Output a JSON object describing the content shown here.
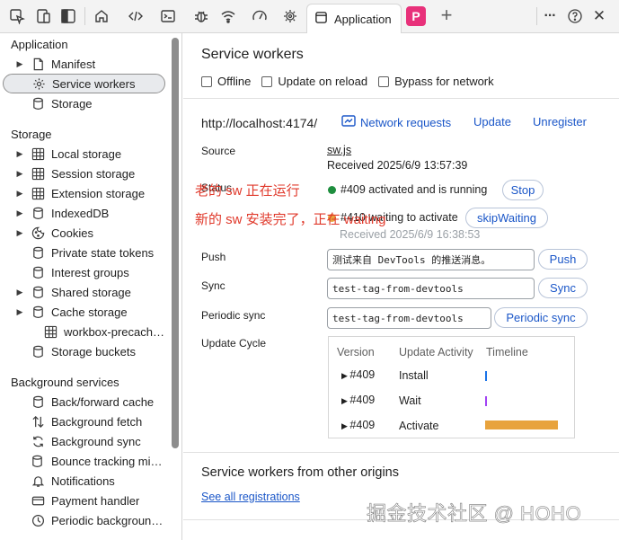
{
  "toolbar": {
    "icons": [
      "inspect-icon",
      "device-toolbar-icon",
      "dock-icon",
      "home-icon",
      "elements-icon",
      "console-icon",
      "sources-icon",
      "network-icon",
      "performance-icon",
      "settings-chip-icon"
    ],
    "active_tab": "Application",
    "badge": "P",
    "new_tab": "+",
    "more": "···",
    "help": "?",
    "close": "✕"
  },
  "sidebar": {
    "application_header": "Application",
    "application_items": [
      {
        "label": "Manifest",
        "icon": "file-icon",
        "arrow": true
      },
      {
        "label": "Service workers",
        "icon": "gear-icon",
        "arrow": false,
        "selected": true
      },
      {
        "label": "Storage",
        "icon": "database-icon",
        "arrow": false
      }
    ],
    "storage_header": "Storage",
    "storage_items": [
      {
        "label": "Local storage",
        "icon": "table-icon",
        "arrow": true
      },
      {
        "label": "Session storage",
        "icon": "table-icon",
        "arrow": true
      },
      {
        "label": "Extension storage",
        "icon": "table-icon",
        "arrow": true
      },
      {
        "label": "IndexedDB",
        "icon": "database-icon",
        "arrow": true
      },
      {
        "label": "Cookies",
        "icon": "cookie-icon",
        "arrow": true
      },
      {
        "label": "Private state tokens",
        "icon": "database-icon",
        "arrow": false
      },
      {
        "label": "Interest groups",
        "icon": "database-icon",
        "arrow": false
      },
      {
        "label": "Shared storage",
        "icon": "database-icon",
        "arrow": true
      },
      {
        "label": "Cache storage",
        "icon": "database-icon",
        "arrow": true
      },
      {
        "label": "workbox-precach…",
        "icon": "table-icon",
        "arrow": false,
        "indent": true
      },
      {
        "label": "Storage buckets",
        "icon": "database-icon",
        "arrow": false
      }
    ],
    "background_header": "Background services",
    "background_items": [
      {
        "label": "Back/forward cache",
        "icon": "database-icon"
      },
      {
        "label": "Background fetch",
        "icon": "up-down-arrows-icon"
      },
      {
        "label": "Background sync",
        "icon": "sync-icon"
      },
      {
        "label": "Bounce tracking mit…",
        "icon": "database-icon"
      },
      {
        "label": "Notifications",
        "icon": "bell-icon"
      },
      {
        "label": "Payment handler",
        "icon": "card-icon"
      },
      {
        "label": "Periodic backgroun…",
        "icon": "clock-icon"
      }
    ]
  },
  "main": {
    "title": "Service workers",
    "checkboxes": [
      "Offline",
      "Update on reload",
      "Bypass for network"
    ],
    "url": "http://localhost:4174/",
    "network_requests": "Network requests",
    "update": "Update",
    "unregister": "Unregister",
    "source_label": "Source",
    "source_link": "sw.js",
    "received": "Received 2025/6/9 13:57:39",
    "status_label": "Status",
    "status_active": "#409 activated and is running",
    "stop_button": "Stop",
    "status_waiting": "#410 waiting to activate",
    "skip_waiting_button": "skipWaiting",
    "received_waiting": "Received 2025/6/9 16:38:53",
    "annotation_old": "老的 sw 正在运行",
    "annotation_new": "新的 sw 安装完了，正在 waiting",
    "push_label": "Push",
    "push_value": "测试来自 DevTools 的推送消息。",
    "push_button": "Push",
    "sync_label": "Sync",
    "sync_value": "test-tag-from-devtools",
    "sync_button": "Sync",
    "periodic_label": "Periodic sync",
    "periodic_value": "test-tag-from-devtools",
    "periodic_button": "Periodic sync",
    "cycle_label": "Update Cycle",
    "cycle_headers": [
      "Version",
      "Update Activity",
      "Timeline"
    ],
    "cycle_rows": [
      {
        "version": "#409",
        "activity": "Install"
      },
      {
        "version": "#409",
        "activity": "Wait"
      },
      {
        "version": "#409",
        "activity": "Activate"
      }
    ],
    "other_title": "Service workers from other origins",
    "see_all": "See all registrations"
  },
  "watermark": "掘金技术社区 @ HOHO",
  "colors": {
    "running_dot": "#1e8e3e",
    "waiting_dot": "#e8a33d",
    "link_blue": "#1a56c8",
    "annotation_red": "#e0392b",
    "activate_bar": "#e8a33d",
    "install_tick": "#1a73e8",
    "wait_tick": "#a142f4"
  }
}
